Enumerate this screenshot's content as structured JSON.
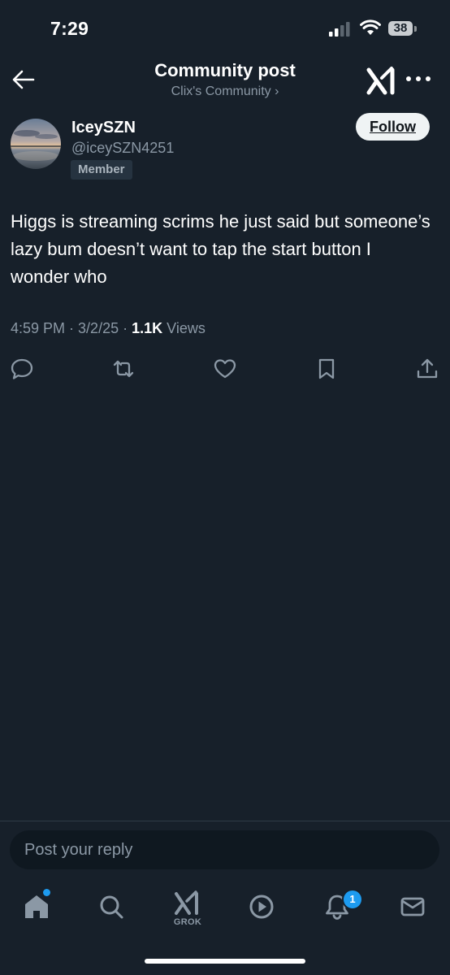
{
  "status_bar": {
    "time": "7:29",
    "battery": "38"
  },
  "header": {
    "title": "Community post",
    "subtitle": "Clix's Community ›"
  },
  "post": {
    "author_name": "IceySZN",
    "author_handle": "@iceySZN4251",
    "member_badge": "Member",
    "follow_label": "Follow",
    "text": "Higgs is streaming scrims he just said but someone’s lazy bum doesn’t want to tap the start button I wonder who",
    "time": "4:59 PM",
    "date": "3/2/25",
    "views_count": "1.1K",
    "views_label": "Views"
  },
  "reply": {
    "placeholder": "Post your reply"
  },
  "bottom_nav": {
    "grok_label": "GROK",
    "notification_count": "1"
  },
  "colors": {
    "background": "#17202a",
    "accent": "#1d9bf0",
    "muted": "#8b98a5"
  }
}
